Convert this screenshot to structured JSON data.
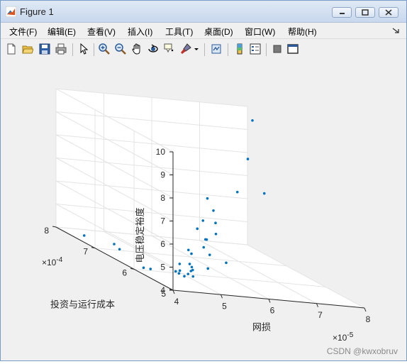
{
  "window": {
    "title": "Figure 1"
  },
  "menu": [
    "文件(F)",
    "编辑(E)",
    "查看(V)",
    "插入(I)",
    "工具(T)",
    "桌面(D)",
    "窗口(W)",
    "帮助(H)"
  ],
  "toolbar_icons": [
    "new-file-icon",
    "open-folder-icon",
    "save-icon",
    "print-icon",
    "pointer-icon",
    "zoom-in-icon",
    "zoom-out-icon",
    "pan-icon",
    "rotate-3d-icon",
    "data-cursor-icon",
    "brush-icon",
    "dropdown-arrow-icon",
    "link-plot-icon",
    "colorbar-icon",
    "legend-icon",
    "hide-tools-icon",
    "dock-icon"
  ],
  "watermark": "CSDN @kwxobruv",
  "chart_data": {
    "type": "scatter3d",
    "xlabel": "网损",
    "ylabel": "投资与运行成本",
    "zlabel": "电压稳定裕度",
    "x_exponent": "×10^-5",
    "y_exponent": "×10^-4",
    "xlim": [
      4,
      8
    ],
    "ylim": [
      5,
      8
    ],
    "zlim": [
      4,
      10
    ],
    "x_ticks": [
      "4",
      "5",
      "6",
      "7",
      "8"
    ],
    "y_ticks": [
      "5",
      "6",
      "7",
      "8"
    ],
    "z_ticks": [
      "4",
      "5",
      "6",
      "7",
      "8",
      "9",
      "10"
    ],
    "marker_color": "#0072bd",
    "points": [
      {
        "x": 7.9,
        "y": 7.75,
        "z": 9.6
      },
      {
        "x": 7.6,
        "y": 7.5,
        "z": 8.1
      },
      {
        "x": 7.7,
        "y": 7.2,
        "z": 6.9
      },
      {
        "x": 7.3,
        "y": 7.4,
        "z": 6.7
      },
      {
        "x": 7.0,
        "y": 7.8,
        "z": 6.0
      },
      {
        "x": 6.8,
        "y": 7.4,
        "z": 5.8
      },
      {
        "x": 6.5,
        "y": 7.3,
        "z": 5.4
      },
      {
        "x": 6.6,
        "y": 7.1,
        "z": 5.5
      },
      {
        "x": 6.3,
        "y": 7.2,
        "z": 5.1
      },
      {
        "x": 6.2,
        "y": 6.6,
        "z": 5.4
      },
      {
        "x": 5.9,
        "y": 6.5,
        "z": 5.2
      },
      {
        "x": 5.6,
        "y": 6.1,
        "z": 5.5
      },
      {
        "x": 5.7,
        "y": 6.3,
        "z": 5.0
      },
      {
        "x": 5.3,
        "y": 6.2,
        "z": 4.9
      },
      {
        "x": 5.2,
        "y": 6.0,
        "z": 4.9
      },
      {
        "x": 5.5,
        "y": 5.9,
        "z": 5.0
      },
      {
        "x": 5.3,
        "y": 5.7,
        "z": 4.55
      },
      {
        "x": 5.6,
        "y": 5.6,
        "z": 4.95
      },
      {
        "x": 5.0,
        "y": 5.8,
        "z": 4.6
      },
      {
        "x": 4.9,
        "y": 5.6,
        "z": 4.5
      },
      {
        "x": 4.8,
        "y": 5.5,
        "z": 4.7
      },
      {
        "x": 4.75,
        "y": 5.75,
        "z": 4.6
      },
      {
        "x": 4.7,
        "y": 5.4,
        "z": 4.6
      },
      {
        "x": 4.6,
        "y": 5.35,
        "z": 4.5
      },
      {
        "x": 4.55,
        "y": 5.5,
        "z": 4.5
      },
      {
        "x": 4.45,
        "y": 5.4,
        "z": 4.45
      },
      {
        "x": 4.4,
        "y": 5.2,
        "z": 4.5
      },
      {
        "x": 4.5,
        "y": 5.1,
        "z": 4.6
      },
      {
        "x": 4.3,
        "y": 5.3,
        "z": 4.6
      },
      {
        "x": 4.1,
        "y": 5.7,
        "z": 4.3
      },
      {
        "x": 4.2,
        "y": 6.0,
        "z": 4.1
      },
      {
        "x": 4.35,
        "y": 6.8,
        "z": 4.2
      },
      {
        "x": 4.1,
        "y": 7.4,
        "z": 4.2
      },
      {
        "x": 4.4,
        "y": 7.0,
        "z": 4.25
      }
    ]
  }
}
